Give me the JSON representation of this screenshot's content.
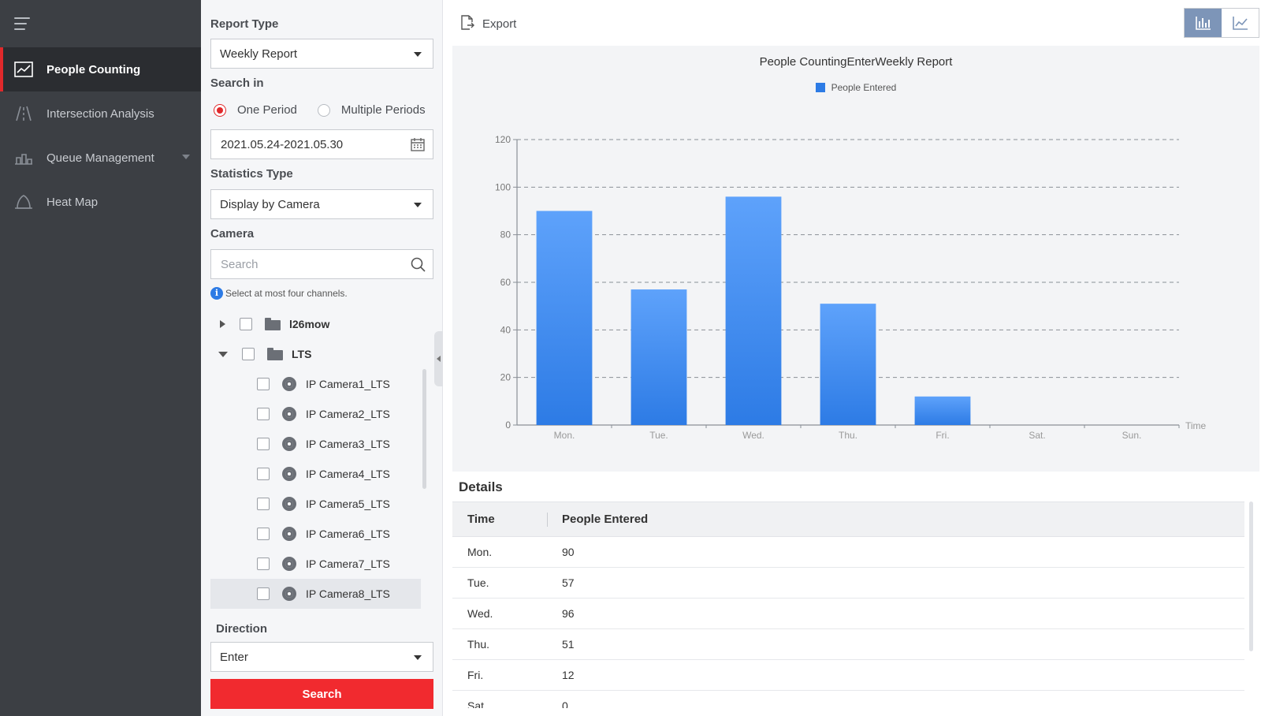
{
  "nav": {
    "items": [
      {
        "label": "People Counting",
        "icon": "people-counting-icon",
        "active": true
      },
      {
        "label": "Intersection Analysis",
        "icon": "intersection-icon",
        "active": false
      },
      {
        "label": "Queue Management",
        "icon": "queue-icon",
        "active": false
      },
      {
        "label": "Heat Map",
        "icon": "heat-map-icon",
        "active": false
      }
    ]
  },
  "filter": {
    "report_type_label": "Report Type",
    "report_type_value": "Weekly Report",
    "search_in_label": "Search in",
    "one_period": "One Period",
    "multiple_periods": "Multiple Periods",
    "date_range": "2021.05.24-2021.05.30",
    "statistics_type_label": "Statistics Type",
    "statistics_type_value": "Display by Camera",
    "camera_label": "Camera",
    "camera_search_placeholder": "Search",
    "hint": "Select at most four channels.",
    "tree": [
      {
        "name": "l26mow",
        "type": "folder",
        "expanded": false
      },
      {
        "name": "LTS",
        "type": "folder",
        "expanded": true
      }
    ],
    "cameras": [
      "IP Camera1_LTS",
      "IP Camera2_LTS",
      "IP Camera3_LTS",
      "IP Camera4_LTS",
      "IP Camera5_LTS",
      "IP Camera6_LTS",
      "IP Camera7_LTS",
      "IP Camera8_LTS"
    ],
    "direction_label": "Direction",
    "direction_value": "Enter",
    "search_button": "Search"
  },
  "main": {
    "export_label": "Export",
    "details_title": "Details",
    "table": {
      "headers": [
        "Time",
        "People Entered"
      ],
      "rows": [
        [
          "Mon.",
          "90"
        ],
        [
          "Tue.",
          "57"
        ],
        [
          "Wed.",
          "96"
        ],
        [
          "Thu.",
          "51"
        ],
        [
          "Fri.",
          "12"
        ],
        [
          "Sat.",
          "0"
        ]
      ]
    }
  },
  "colors": {
    "accent": "#e0292b",
    "bar": "#2d7be5",
    "search_button": "#f12a2f"
  },
  "chart_data": {
    "type": "bar",
    "title": "People CountingEnterWeekly Report",
    "xlabel": "Time",
    "ylabel": "",
    "categories": [
      "Mon.",
      "Tue.",
      "Wed.",
      "Thu.",
      "Fri.",
      "Sat.",
      "Sun."
    ],
    "series": [
      {
        "name": "People Entered",
        "values": [
          90,
          57,
          96,
          51,
          12,
          0,
          0
        ]
      }
    ],
    "ylim": [
      0,
      120
    ],
    "yticks": [
      0,
      20,
      40,
      60,
      80,
      100,
      120
    ],
    "grid": true,
    "legend": "top-center"
  }
}
